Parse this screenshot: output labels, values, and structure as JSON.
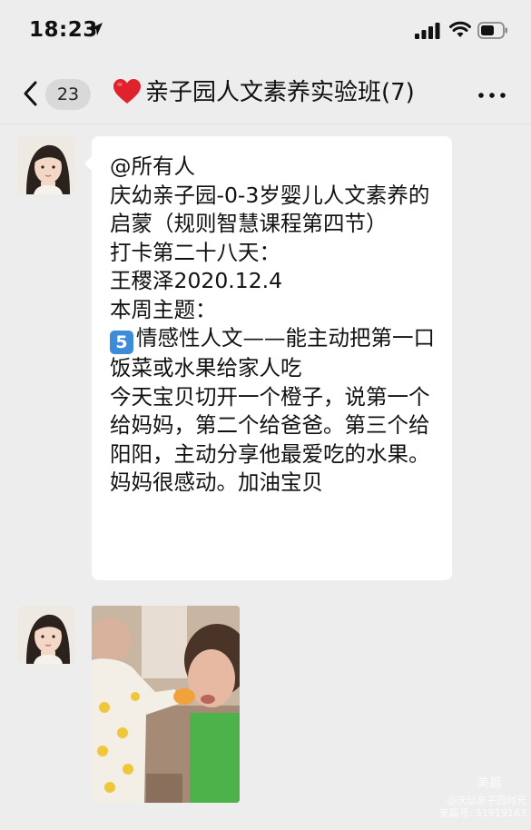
{
  "status_bar": {
    "time": "18:23"
  },
  "header": {
    "unread_count": "23",
    "title": "亲子园人文素养实验班(7)"
  },
  "messages": [
    {
      "type": "text",
      "lines_before_emoji": "@所有人\n庆幼亲子园-0-3岁婴儿人文素养的启蒙（规则智慧课程第四节）\n打卡第二十八天：\n王稷泽2020.12.4\n本周主题：\n",
      "emoji_number": "5",
      "lines_after_emoji": "情感性人文——能主动把第一口饭菜或水果给家人吃\n今天宝贝切开一个橙子，说第一个给妈妈，第二个给爸爸。第三个给阳阳，主动分享他最爱吃的水果。妈妈很感动。加油宝贝"
    },
    {
      "type": "image",
      "watermark_brand": "美篇",
      "watermark_name": "@庆幼亲子园时光",
      "watermark_id": "美篇号: 51919163"
    }
  ],
  "colors": {
    "background": "#ededed",
    "bubble": "#ffffff",
    "emoji_key": "#3d8bd9"
  }
}
